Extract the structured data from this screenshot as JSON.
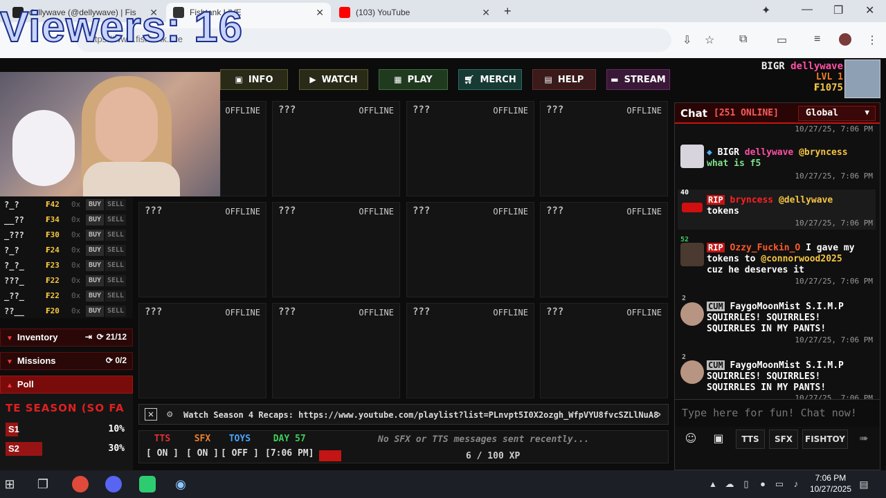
{
  "overlay": {
    "viewers": "Viewers: 16"
  },
  "browser": {
    "tabs": [
      {
        "title": "dellywave (@dellywave) | Fis",
        "favicon_color": "#222222"
      },
      {
        "title": "Fishtank LIVE",
        "favicon_color": "#333333"
      },
      {
        "title": "(103) YouTube",
        "favicon_color": "#ff0000"
      }
    ],
    "url": "https://www.fishtank.live"
  },
  "nav": {
    "info": "INFO",
    "watch": "WATCH",
    "play": "PLAY",
    "merch": "MERCH",
    "help": "HELP",
    "stream": "STREAM"
  },
  "user": {
    "rank": "BIGR",
    "name": "dellywave",
    "level": "LVL 1",
    "coins": "₣1075"
  },
  "cams": [
    {
      "name": "",
      "status": "OFFLINE"
    },
    {
      "name": "???",
      "status": "OFFLINE"
    },
    {
      "name": "???",
      "status": "OFFLINE"
    },
    {
      "name": "???",
      "status": "OFFLINE"
    },
    {
      "name": "???",
      "status": "OFFLINE"
    },
    {
      "name": "???",
      "status": "OFFLINE"
    },
    {
      "name": "???",
      "status": "OFFLINE"
    },
    {
      "name": "???",
      "status": "OFFLINE"
    },
    {
      "name": "???",
      "status": "OFFLINE"
    },
    {
      "name": "???",
      "status": "OFFLINE"
    },
    {
      "name": "???",
      "status": "OFFLINE"
    },
    {
      "name": "???",
      "status": "OFFLINE"
    }
  ],
  "stocks": [
    {
      "sym": "?_?",
      "price": "₣42",
      "owned": "0x"
    },
    {
      "sym": "__??",
      "price": "₣34",
      "owned": "0x"
    },
    {
      "sym": "_???",
      "price": "₣30",
      "owned": "0x"
    },
    {
      "sym": "?_?",
      "price": "₣24",
      "owned": "0x"
    },
    {
      "sym": "?_?_",
      "price": "₣23",
      "owned": "0x"
    },
    {
      "sym": "???_",
      "price": "₣22",
      "owned": "0x"
    },
    {
      "sym": "_??_",
      "price": "₣22",
      "owned": "0x"
    },
    {
      "sym": "??__",
      "price": "₣20",
      "owned": "0x"
    }
  ],
  "stock_buttons": {
    "buy": "BUY",
    "sell": "SELL"
  },
  "sections": {
    "inventory": {
      "label": "Inventory",
      "count": "21/12"
    },
    "missions": {
      "label": "Missions",
      "count": "0/2"
    },
    "poll": {
      "label": "Poll"
    }
  },
  "poll": {
    "title": "TE SEASON (SO FA",
    "options": [
      {
        "label": "S1",
        "pct": "10%",
        "fraction": 0.1
      },
      {
        "label": "S2",
        "pct": "30%",
        "fraction": 0.3
      }
    ]
  },
  "announcement": "Watch Season 4 Recaps: https://www.youtube.com/playlist?list=PLnvpt5I0X2ozgh_WfpVYU8fvcSZLlNuA8",
  "status": {
    "tts_label": "TTS",
    "tts_val": "[ ON ]",
    "sfx_label": "SFX",
    "sfx_val": "[ ON ]",
    "toys_label": "TOYS",
    "toys_val": "[ OFF ]",
    "day_label": "DAY 57",
    "day_val": "[7:06 PM]",
    "message": "No SFX or TTS messages sent recently...",
    "xp": "6 / 100 XP"
  },
  "chat": {
    "title": "Chat",
    "online": "[251 ONLINE]",
    "channel": "Global",
    "top_ts": "10/27/25, 7:06 PM",
    "messages": [
      {
        "tag": "BIGR",
        "user": "dellywave",
        "text": "@bryncess",
        "text2": "what is f5",
        "ts": "10/27/25, 7:06 PM"
      },
      {
        "tag": "RIP",
        "user": "bryncess",
        "text": "@dellywave",
        "text2": "tokens",
        "ts": "10/27/25, 7:06 PM",
        "level": "40"
      },
      {
        "tag": "RIP",
        "user": "Ozzy_Fuckin_O",
        "text": "I gave my",
        "text2": "tokens to",
        "mention": "@connorwood2025",
        "text3": "cuz he deserves it",
        "ts": "10/27/25, 7:06 PM",
        "level": "52"
      },
      {
        "tag": "CUM",
        "user": "FaygoMoonMist",
        "text": "S.I.M.P",
        "text2": "SQUIRRLES! SQUIRRLES!",
        "text3": "SQUIRRLES IN MY PANTS!",
        "ts": "10/27/25, 7:06 PM",
        "level": "2"
      },
      {
        "tag": "CUM",
        "user": "FaygoMoonMist",
        "text": "S.I.M.P",
        "text2": "SQUIRRLES! SQUIRRLES!",
        "text3": "SQUIRRLES IN MY PANTS!",
        "ts": "10/27/25, 7:06 PM",
        "level": "2"
      }
    ],
    "input_placeholder": "Type here for fun! Chat now!",
    "tools": {
      "tts": "TTS",
      "sfx": "SFX",
      "fishtoy": "FISHTOY"
    }
  },
  "taskbar": {
    "time": "7:06 PM",
    "date": "10/27/2025"
  }
}
